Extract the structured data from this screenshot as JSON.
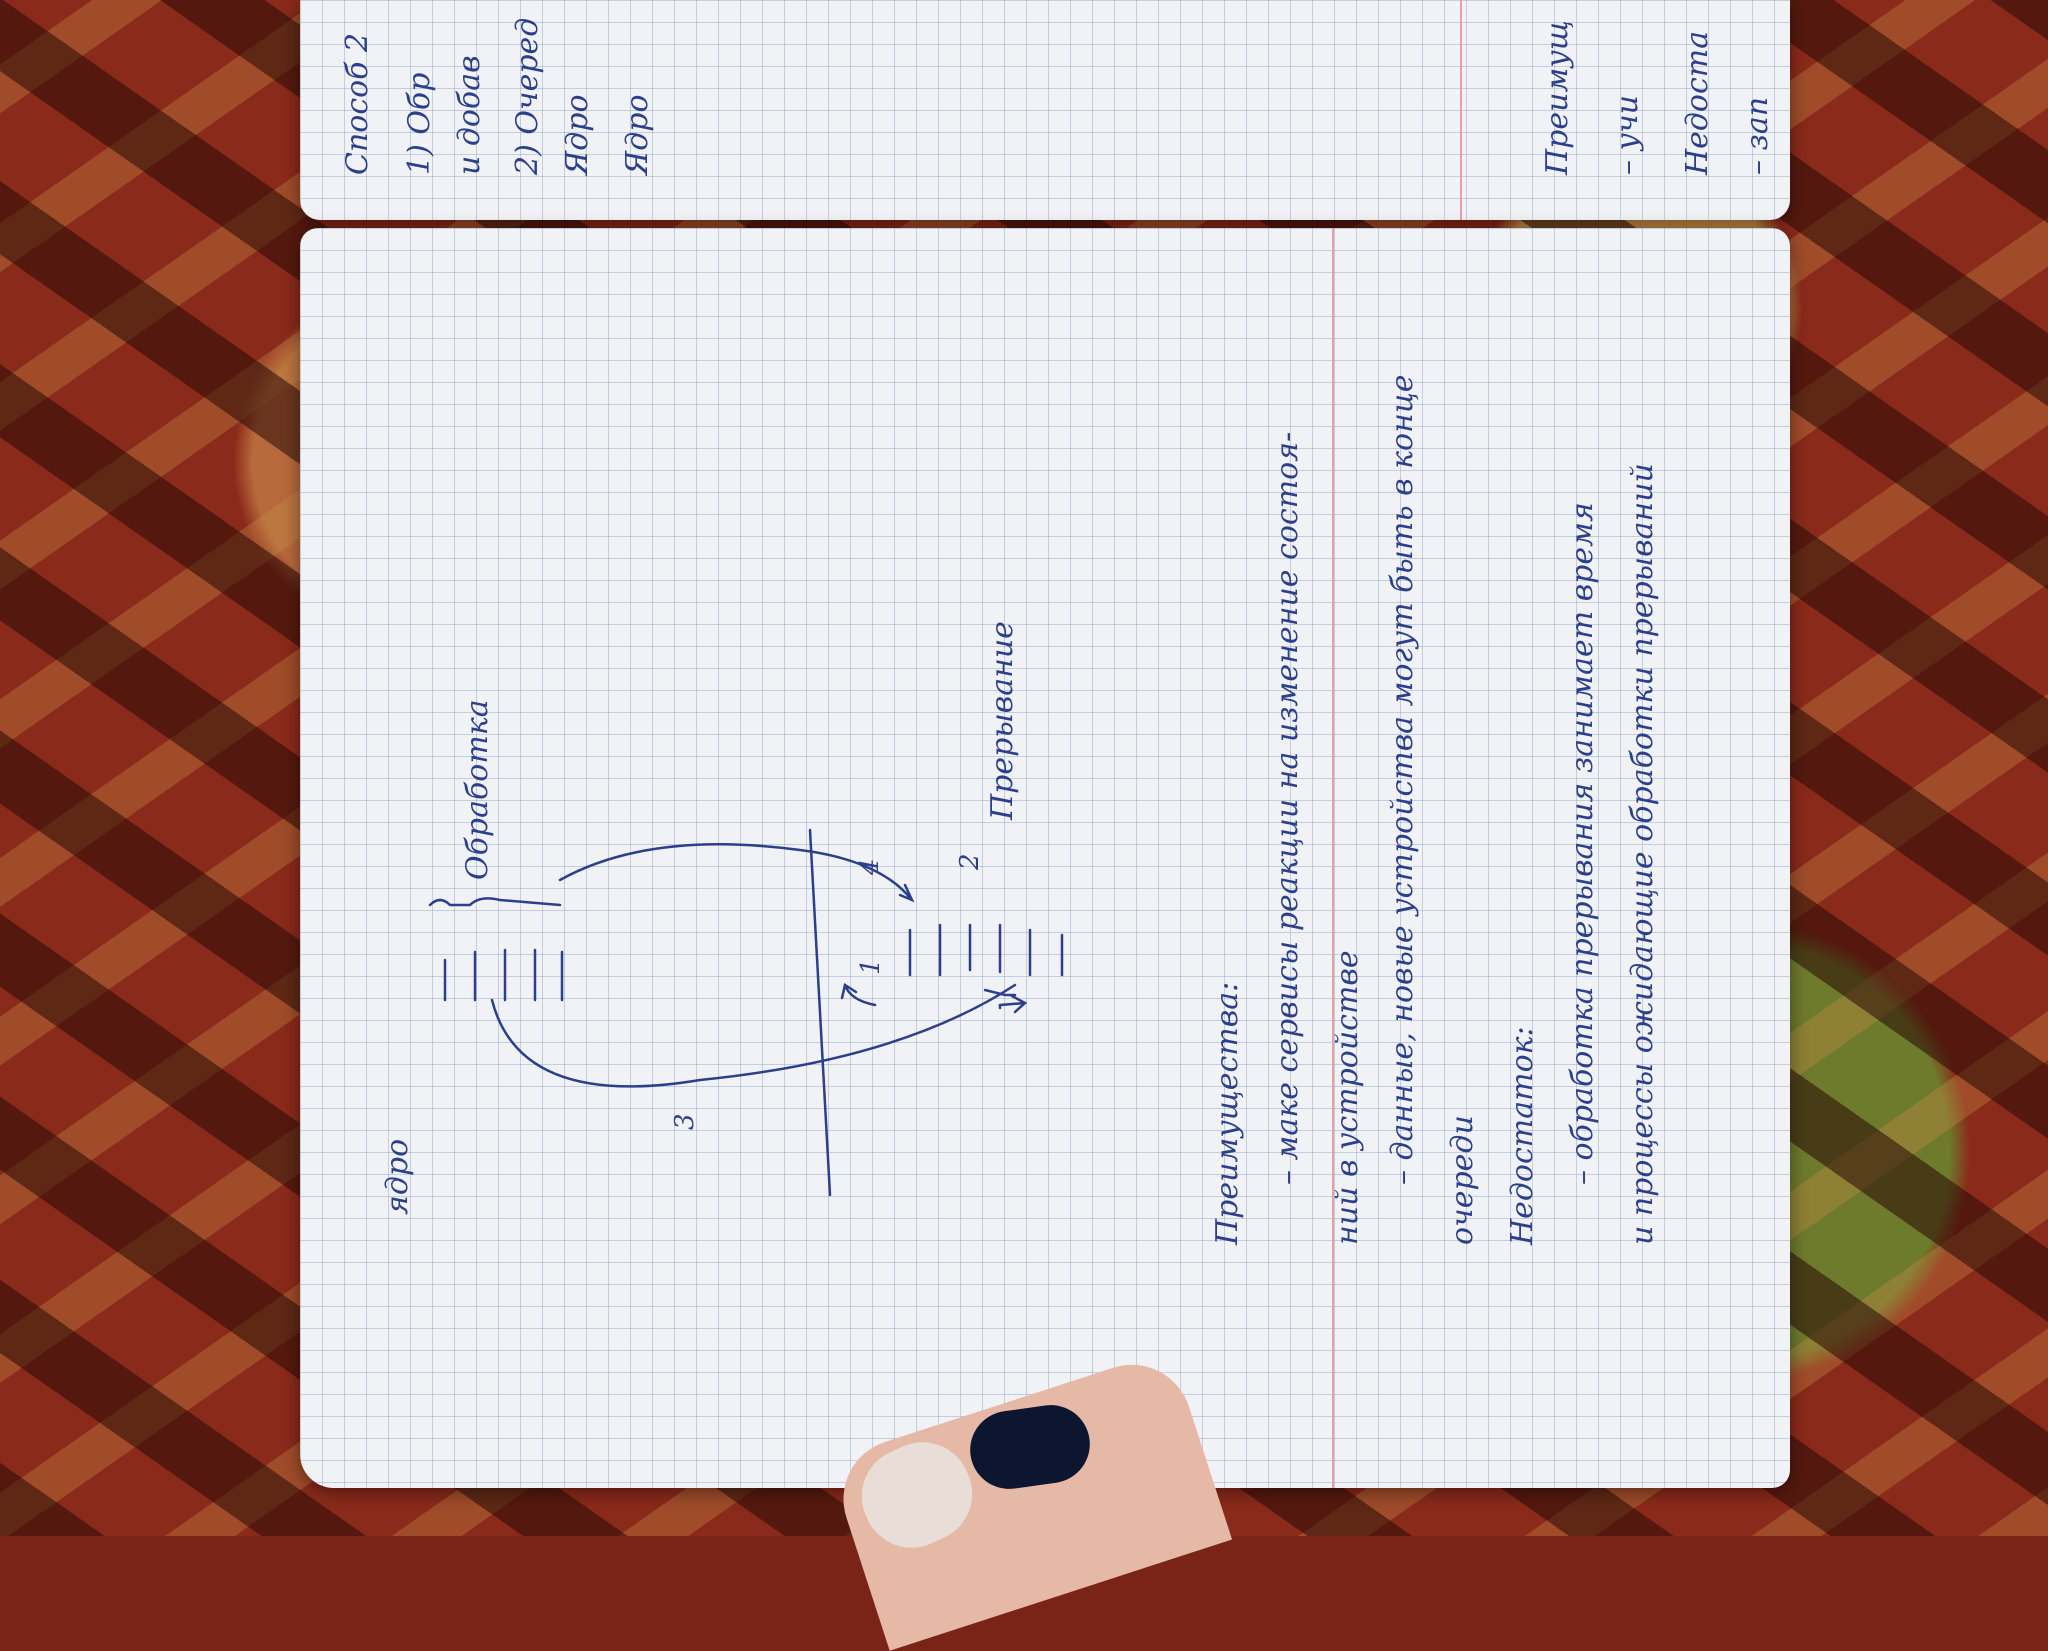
{
  "top_page": {
    "lines": [
      "Способ 2",
      "1) Обр",
      "и добав",
      "2) Очеред",
      "Ядро",
      "Ядро"
    ],
    "right_lines": [
      "Преимущ",
      "– учи",
      "Недоста",
      "– зап"
    ]
  },
  "diagram": {
    "kernel_label": "ядро",
    "processing_label": "Обработка",
    "interrupt_label": "Прерывание",
    "step_labels": [
      "1",
      "2",
      "3",
      "4"
    ]
  },
  "notes": {
    "advantages_heading": "Преимущества:",
    "advantage_1_line_1": "– маке сервисы реакции на изменение состоя-",
    "advantage_1_line_2": "ний в устройстве",
    "advantage_2_line_1": "– данные, новые устройства могут быть в конце",
    "advantage_2_line_2": "очереди",
    "disadvantages_heading": "Недостаток:",
    "disadvantage_1": "– обработка прерывания занимает время",
    "disadvantage_2": "и процессы ожидающие обработки прерываний"
  },
  "colors": {
    "ink": "#2c3f8a",
    "paper": "#f1f2f6",
    "margin": "#e7a0a6"
  }
}
